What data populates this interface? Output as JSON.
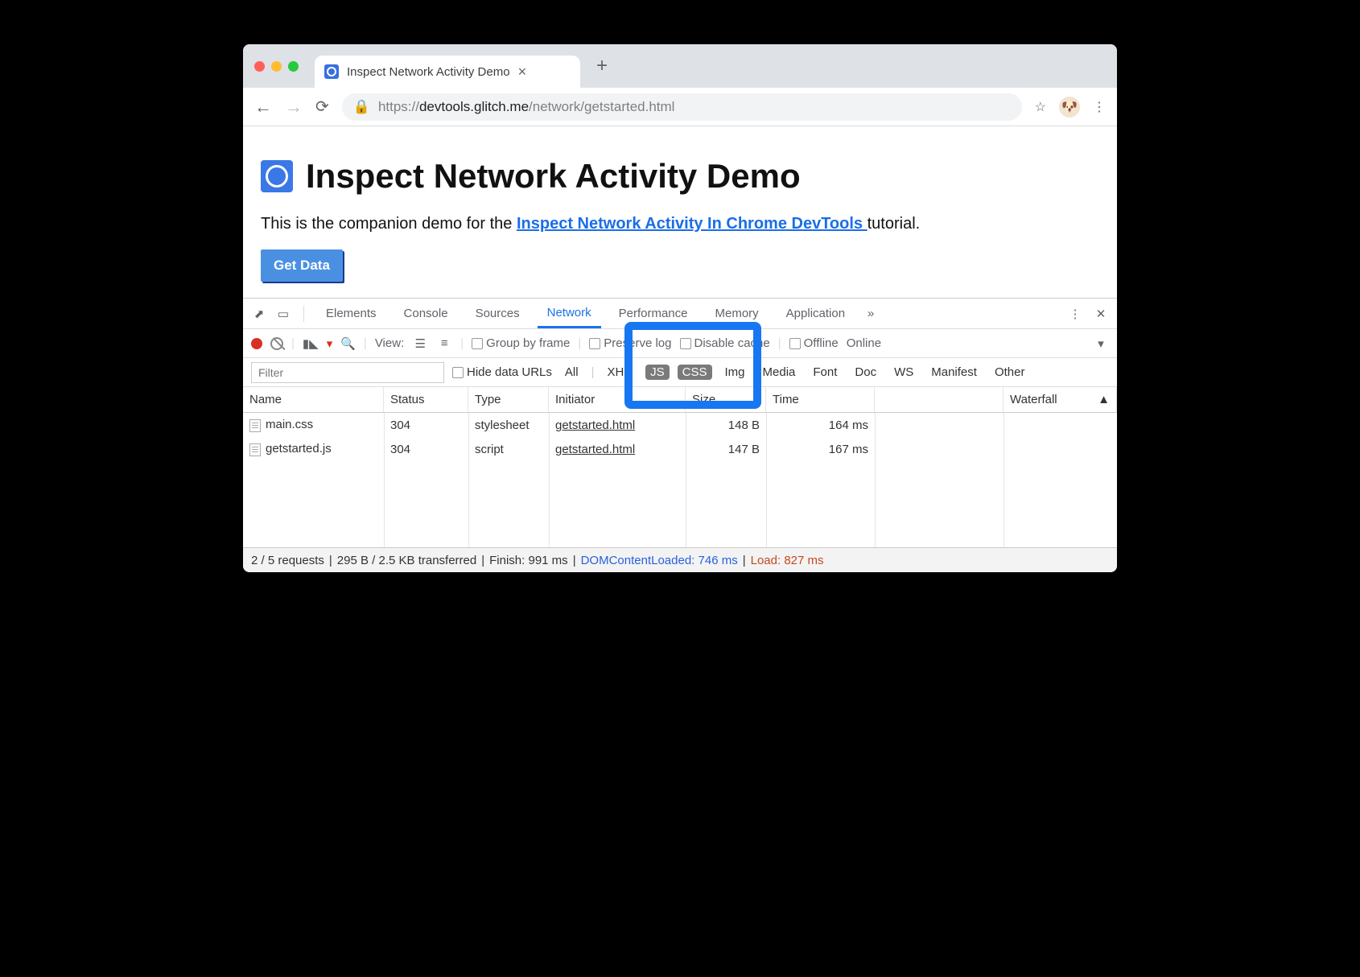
{
  "browser": {
    "tab_title": "Inspect Network Activity Demo",
    "url_prefix": "https://",
    "url_host": "devtools.glitch.me",
    "url_path": "/network/getstarted.html"
  },
  "page": {
    "heading": "Inspect Network Activity Demo",
    "intro_before": "This is the companion demo for the ",
    "link_text": "Inspect Network Activity In Chrome DevTools ",
    "intro_after": "tutorial.",
    "button": "Get Data"
  },
  "devtools": {
    "tabs": [
      "Elements",
      "Console",
      "Sources",
      "Network",
      "Performance",
      "Memory",
      "Application"
    ],
    "active_tab": "Network",
    "toolbar": {
      "view_label": "View:",
      "group_by_frame": "Group by frame",
      "preserve_log": "Preserve log",
      "disable_cache": "Disable cache",
      "offline": "Offline",
      "online": "Online"
    },
    "filterbar": {
      "filter_placeholder": "Filter",
      "hide_urls": "Hide data URLs",
      "types": [
        "All",
        "XHR",
        "JS",
        "CSS",
        "Img",
        "Media",
        "Font",
        "Doc",
        "WS",
        "Manifest",
        "Other"
      ],
      "selected": [
        "JS",
        "CSS"
      ]
    },
    "columns": [
      "Name",
      "Status",
      "Type",
      "Initiator",
      "Size",
      "Time",
      "Waterfall"
    ],
    "rows": [
      {
        "name": "main.css",
        "status": "304",
        "type": "stylesheet",
        "initiator": "getstarted.html",
        "size": "148 B",
        "time": "164 ms"
      },
      {
        "name": "getstarted.js",
        "status": "304",
        "type": "script",
        "initiator": "getstarted.html",
        "size": "147 B",
        "time": "167 ms"
      }
    ],
    "status": {
      "requests": "2 / 5 requests",
      "transferred": "295 B / 2.5 KB transferred",
      "finish": "Finish: 991 ms",
      "dcl": "DOMContentLoaded: 746 ms",
      "load": "Load: 827 ms"
    }
  }
}
